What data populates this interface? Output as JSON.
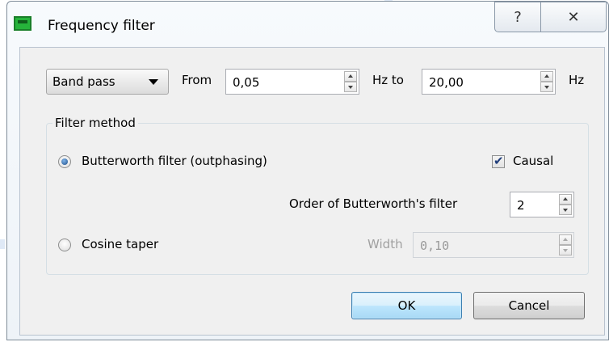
{
  "window": {
    "title": "Frequency filter",
    "help_glyph": "?",
    "close_glyph": "✕"
  },
  "filter": {
    "type_selected": "Band pass",
    "from_label": "From",
    "from_value": "0,05",
    "hz_to_label": "Hz to",
    "to_value": "20,00",
    "hz_label": "Hz"
  },
  "method_group": {
    "title": "Filter method",
    "butterworth_label": "Butterworth filter (outphasing)",
    "butterworth_selected": true,
    "causal_label": "Causal",
    "causal_checked": true,
    "order_label": "Order of Butterworth's filter",
    "order_value": "2",
    "cosine_label": "Cosine taper",
    "cosine_selected": false,
    "width_label": "Width",
    "width_value": "0,10"
  },
  "buttons": {
    "ok": "OK",
    "cancel": "Cancel"
  },
  "colors": {
    "default_button_border": "#3c7fb1",
    "radio_dot": "#1d4e8a",
    "app_icon": "#26b33b"
  }
}
